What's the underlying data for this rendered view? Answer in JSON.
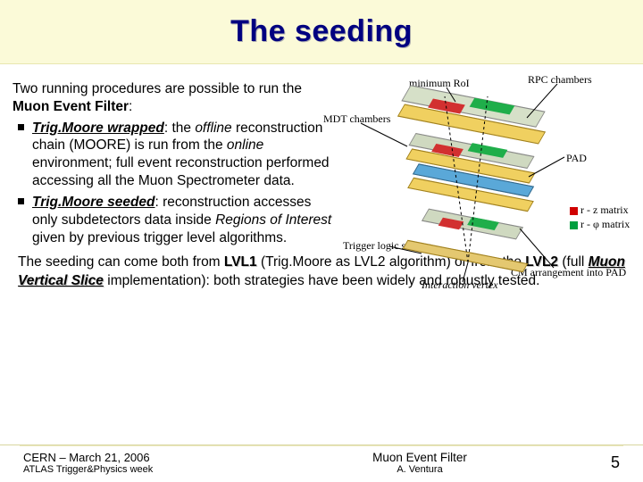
{
  "title": "The seeding",
  "intro_pre": "Two running procedures are possible to run the ",
  "intro_bold": "Muon Event Filter",
  "intro_post": ":",
  "bullets": [
    {
      "head": "Trig.Moore wrapped",
      "seg1": ": the ",
      "seg2": "offline",
      "seg3": " reconstruction chain (MOORE) is run from the ",
      "seg4": "online",
      "seg5": " environment; full event reconstruction performed accessing all the Muon Spectrometer data."
    },
    {
      "head": "Trig.Moore seeded",
      "seg1": ": reconstruction accesses only subdetectors data inside ",
      "seg2": "Regions of Interest",
      "seg3": " given by previous trigger level algorithms."
    }
  ],
  "below": {
    "t1": "The seeding can come both from ",
    "lvl1": "LVL1",
    "t2": " (Trig.Moore as LVL2 algorithm) or from the ",
    "lvl2": "LVL2",
    "t3": " (full ",
    "mvs": "Muon Vertical Slice",
    "t4": " implementation): both strategies have been widely and robustly tested."
  },
  "diagram": {
    "roi": "minimum RoI",
    "rpc": "RPC chambers",
    "mdt": "MDT chambers",
    "pad": "PAD",
    "tls": "Trigger logic sectors",
    "vertex": "Interaction vertex",
    "cm": "CM arrangement into PAD",
    "rz": "r - z matrix",
    "rphi": "r - φ matrix"
  },
  "footer": {
    "left_line1": "CERN – March 21, 2006",
    "left_line2": "ATLAS Trigger&Physics week",
    "mid_line1": "Muon Event Filter",
    "mid_line2": "A. Ventura",
    "page": "5"
  }
}
